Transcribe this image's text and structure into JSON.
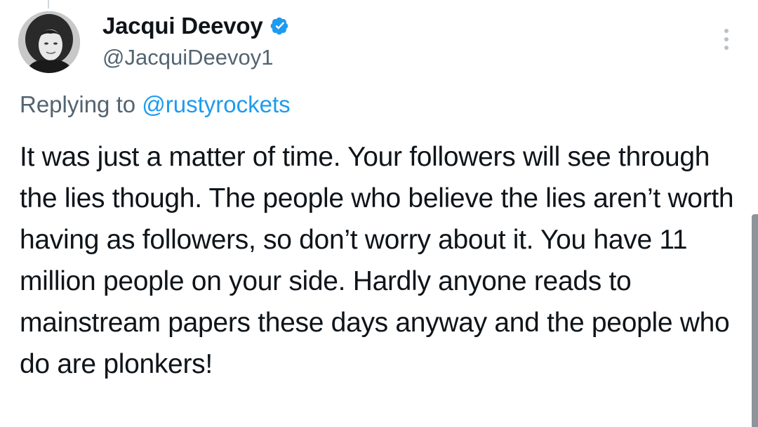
{
  "tweet": {
    "author": {
      "display_name": "Jacqui Deevoy",
      "handle": "@JacquiDeevoy1",
      "verified": true,
      "avatar_icon": "profile-photo"
    },
    "replying_to_prefix": "Replying to",
    "replying_to_handle": "@rustyrockets",
    "text": "It was just a matter of time. Your followers will see through the lies though. The people who believe the lies aren’t worth having as followers, so don’t worry about it. You have 11 million people on your side. Hardly anyone reads to mainstream papers these days anyway and the people who do are plonkers!"
  },
  "icons": {
    "verified": "verified-badge-icon",
    "more": "more-options-icon"
  },
  "colors": {
    "text_primary": "#0f1419",
    "text_secondary": "#536471",
    "link": "#1d9bf0",
    "verified_badge": "#1d9bf0"
  }
}
